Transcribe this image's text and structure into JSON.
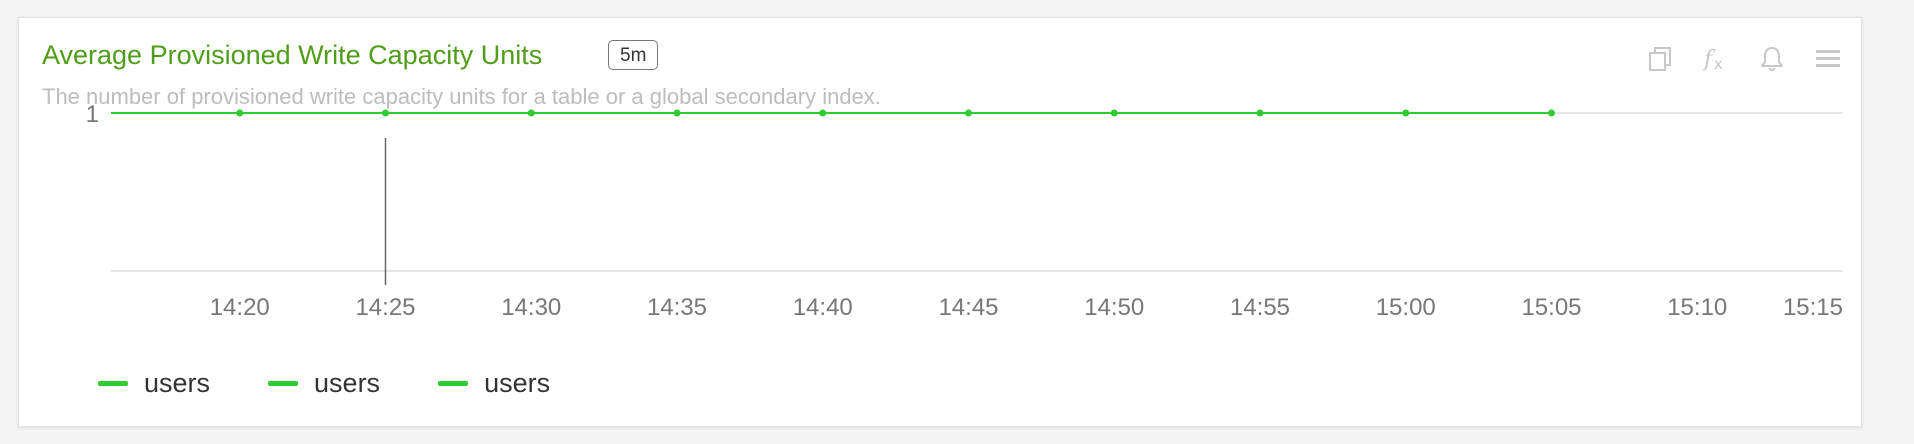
{
  "header": {
    "title": "Average Provisioned Write Capacity Units",
    "interval_badge": "5m",
    "subtitle": "The number of provisioned write capacity units for a table or a global secondary index."
  },
  "toolbar": {
    "icons": [
      "copy-icon",
      "function-icon",
      "bell-icon",
      "menu-icon"
    ]
  },
  "colors": {
    "series": "#2fcc2f",
    "title": "#4f9d1a",
    "grid": "#dddddd",
    "axis_text": "#777777",
    "crosshair": "#666666"
  },
  "chart_data": {
    "type": "line",
    "x": [
      "14:20",
      "14:25",
      "14:30",
      "14:35",
      "14:40",
      "14:45",
      "14:50",
      "14:55",
      "15:00",
      "15:05"
    ],
    "x_ticks": [
      "14:20",
      "14:25",
      "14:30",
      "14:35",
      "14:40",
      "14:45",
      "14:50",
      "14:55",
      "15:00",
      "15:05",
      "15:10",
      "15:15"
    ],
    "x_range": [
      "14:15:35",
      "15:15"
    ],
    "y_ticks": [
      "1"
    ],
    "ylim": [
      0.2,
      1.0
    ],
    "series": [
      {
        "name": "users",
        "values": [
          1,
          1,
          1,
          1,
          1,
          1,
          1,
          1,
          1,
          1
        ]
      }
    ],
    "crosshair_x": "14:25",
    "grid": true,
    "legend": {
      "position": "bottom-left",
      "entries": [
        "users",
        "users",
        "users"
      ]
    },
    "title": "Average Provisioned Write Capacity Units",
    "xlabel": "",
    "ylabel": ""
  }
}
